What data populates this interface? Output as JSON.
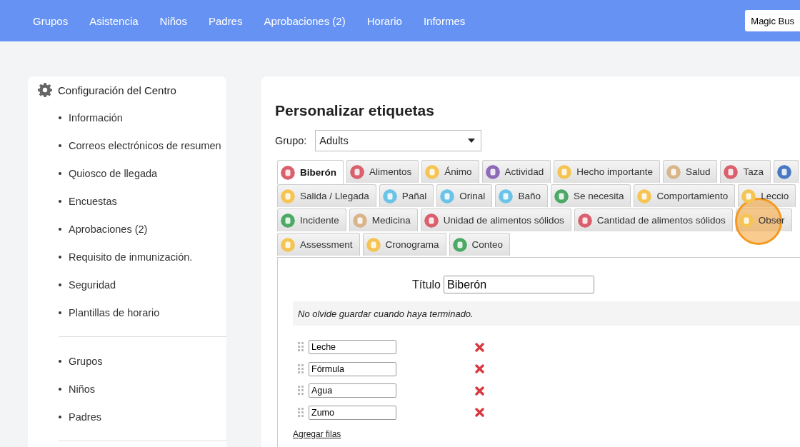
{
  "nav": {
    "items": [
      {
        "label": "Grupos"
      },
      {
        "label": "Asistencia"
      },
      {
        "label": "Niños"
      },
      {
        "label": "Padres"
      },
      {
        "label": "Aprobaciones (2)"
      },
      {
        "label": "Horario"
      },
      {
        "label": "Informes"
      }
    ],
    "account": "Magic Bus"
  },
  "sidebar": {
    "title": "Configuración del Centro",
    "sections": [
      [
        "Información",
        "Correos electrónicos de resumen",
        "Quiosco de llegada",
        "Encuestas",
        "Aprobaciones (2)",
        "Requisito de inmunización.",
        "Seguridad",
        "Plantillas de horario"
      ],
      [
        "Grupos",
        "Niños",
        "Padres"
      ]
    ]
  },
  "editor": {
    "heading": "Personalizar etiquetas",
    "group_label": "Grupo:",
    "group_value": "Adults",
    "tab_rows": [
      [
        {
          "label": "Biberón",
          "color": "#d9606c",
          "selected": true
        },
        {
          "label": "Alimentos",
          "color": "#d9606c",
          "selected": false
        },
        {
          "label": "Ánimo",
          "color": "#f5c453",
          "selected": false
        },
        {
          "label": "Actividad",
          "color": "#8d6bb8",
          "selected": false
        },
        {
          "label": "Hecho importante",
          "color": "#f5c453",
          "selected": false
        },
        {
          "label": "Salud",
          "color": "#d9b58c",
          "selected": false
        },
        {
          "label": "Taza",
          "color": "#d9606c",
          "selected": false
        },
        {
          "color": "#4a78c2",
          "selected": false
        }
      ],
      [
        {
          "label": "Salida / Llegada",
          "color": "#f5c453",
          "selected": false
        },
        {
          "label": "Pañal",
          "color": "#6cc3e8",
          "selected": false
        },
        {
          "label": "Orinal",
          "color": "#6cc3e8",
          "selected": false
        },
        {
          "label": "Baño",
          "color": "#6cc3e8",
          "selected": false
        },
        {
          "label": "Se necesita",
          "color": "#4caa66",
          "selected": false
        },
        {
          "label": "Comportamiento",
          "color": "#f5c453",
          "selected": false
        },
        {
          "label": "Leccio",
          "color": "#f5c453",
          "selected": false
        }
      ],
      [
        {
          "label": "Incidente",
          "color": "#4caa66",
          "selected": false
        },
        {
          "label": "Medicina",
          "color": "#d9b58c",
          "selected": false
        },
        {
          "label": "Unidad de alimentos sólidos",
          "color": "#d9606c",
          "selected": false
        },
        {
          "label": "Cantidad de alimentos sólidos",
          "color": "#d9606c",
          "selected": false
        },
        {
          "label": "Obser",
          "color": "#f5c453",
          "selected": false
        }
      ],
      [
        {
          "label": "Assessment",
          "color": "#f5c453",
          "selected": false
        },
        {
          "label": "Cronograma",
          "color": "#f5c453",
          "selected": false
        },
        {
          "label": "Conteo",
          "color": "#4caa66",
          "selected": false
        }
      ]
    ],
    "title_label": "Título",
    "title_value": "Biberón",
    "notice": "No olvide guardar cuando haya terminado.",
    "options": [
      "Leche",
      "Fórmula",
      "Agua",
      "Zumo"
    ],
    "add_rows": "Agregar filas"
  }
}
